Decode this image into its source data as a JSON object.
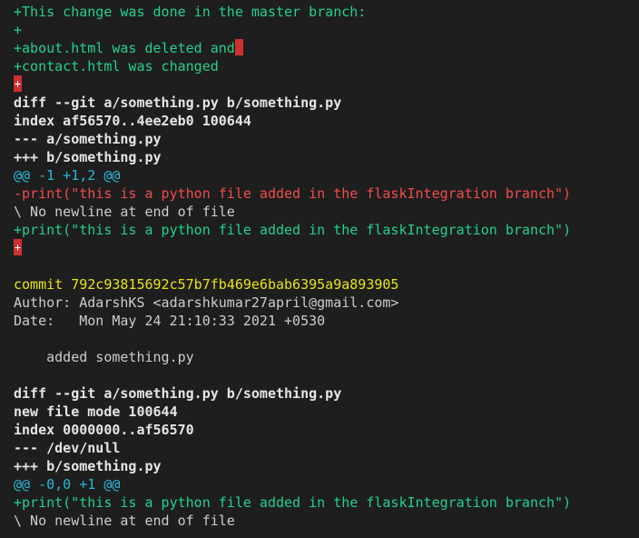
{
  "lines": [
    {
      "text": "+This change was done in the master branch:",
      "kind": "add"
    },
    {
      "text": "+",
      "kind": "add"
    },
    {
      "text": "+about.html was deleted and",
      "kind": "add",
      "trailing_ws": true
    },
    {
      "text": "+contact.html was changed",
      "kind": "add"
    },
    {
      "text": "+",
      "kind": "ws_marker"
    },
    {
      "text": "diff --git a/something.py b/something.py",
      "kind": "bold"
    },
    {
      "text": "index af56570..4ee2eb0 100644",
      "kind": "bold"
    },
    {
      "text": "--- a/something.py",
      "kind": "bold"
    },
    {
      "text": "+++ b/something.py",
      "kind": "bold"
    },
    {
      "text": "@@ -1 +1,2 @@",
      "kind": "hunk"
    },
    {
      "text": "-print(\"this is a python file added in the flaskIntegration branch\")",
      "kind": "del"
    },
    {
      "text": "\\ No newline at end of file",
      "kind": "plain"
    },
    {
      "text": "+print(\"this is a python file added in the flaskIntegration branch\")",
      "kind": "add"
    },
    {
      "text": "+",
      "kind": "ws_marker"
    },
    {
      "text": "",
      "kind": "plain"
    },
    {
      "text": "commit 792c93815692c57b7fb469e6bab6395a9a893905",
      "kind": "commit"
    },
    {
      "text": "Author: AdarshKS <adarshkumar27april@gmail.com>",
      "kind": "plain"
    },
    {
      "text": "Date:   Mon May 24 21:10:33 2021 +0530",
      "kind": "plain"
    },
    {
      "text": "",
      "kind": "plain"
    },
    {
      "text": "    added something.py",
      "kind": "plain"
    },
    {
      "text": "",
      "kind": "plain"
    },
    {
      "text": "diff --git a/something.py b/something.py",
      "kind": "bold"
    },
    {
      "text": "new file mode 100644",
      "kind": "bold"
    },
    {
      "text": "index 0000000..af56570",
      "kind": "bold"
    },
    {
      "text": "--- /dev/null",
      "kind": "bold"
    },
    {
      "text": "+++ b/something.py",
      "kind": "bold"
    },
    {
      "text": "@@ -0,0 +1 @@",
      "kind": "hunk"
    },
    {
      "text": "+print(\"this is a python file added in the flaskIntegration branch\")",
      "kind": "add"
    },
    {
      "text": "\\ No newline at end of file",
      "kind": "plain"
    }
  ]
}
